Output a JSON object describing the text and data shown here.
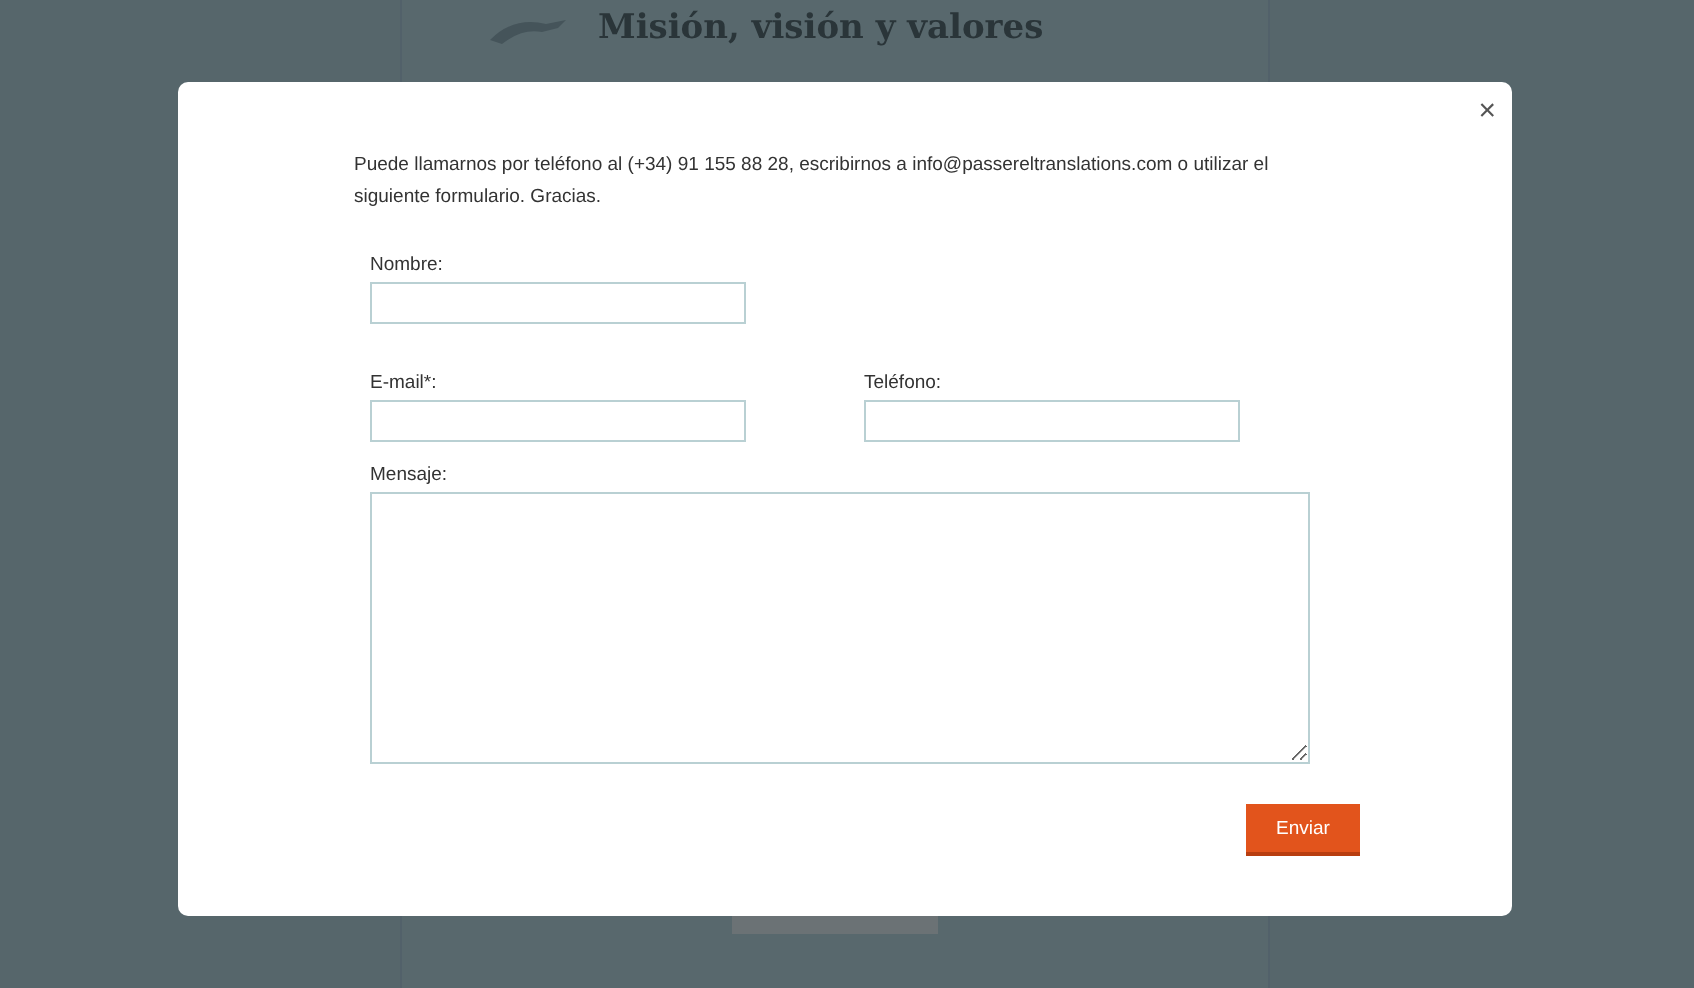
{
  "background_page": {
    "heading": "Misión, visión y valores"
  },
  "modal": {
    "close": "×",
    "intro": "Puede llamarnos por teléfono al (+34) 91 155 88 28, escribirnos a info@passereltranslations.com  o utilizar el siguiente formulario. Gracias.",
    "fields": [
      {
        "kind": "input",
        "label": "Nombre:"
      },
      {
        "kind": "input",
        "label": "E-mail*:"
      },
      {
        "kind": "input",
        "label": "Teléfono:"
      },
      {
        "kind": "textarea",
        "label": "Mensaje:"
      }
    ],
    "submit": "Enviar"
  }
}
